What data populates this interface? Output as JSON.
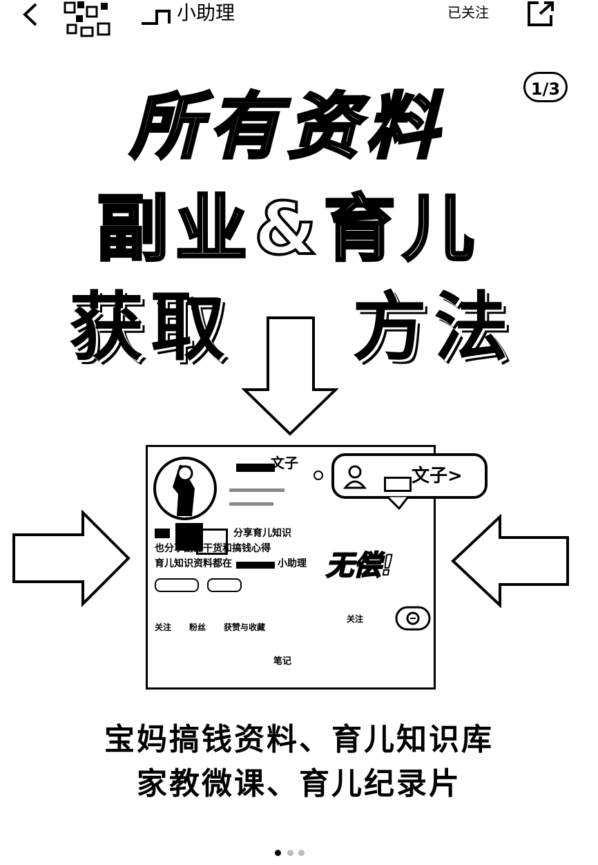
{
  "topbar": {
    "account_name": "小助理",
    "follow_status": "已关注",
    "back_icon": "chevron-left-icon",
    "share_icon": "share-icon"
  },
  "page_badge": "1/3",
  "headline": {
    "line1": "所有资料",
    "line2": "副业&育儿",
    "line3_left": "获取",
    "line3_right": "方法"
  },
  "profile_card": {
    "name_suffix": "文子",
    "pill_name": "文子",
    "pill_chevron": ">",
    "bio_line1_end": "分享育儿知识",
    "bio_line2": "也分享副业干货和搞钱心得",
    "bio_line3": "育儿知识资料都在",
    "bio_line3_end": "小助理",
    "stats": [
      "关注",
      "粉丝",
      "获赞与收藏"
    ],
    "follow_button": "关注",
    "notes_tab": "笔记",
    "stamp": "无偿!"
  },
  "caption": {
    "line1": "宝妈搞钱资料、育儿知识库",
    "line2": "家教微课、育儿纪录片"
  },
  "pager": {
    "count": 3,
    "active": 1
  },
  "colors": {
    "ink": "#000000",
    "paper": "#ffffff",
    "dot_inactive": "#bdbdbd"
  }
}
